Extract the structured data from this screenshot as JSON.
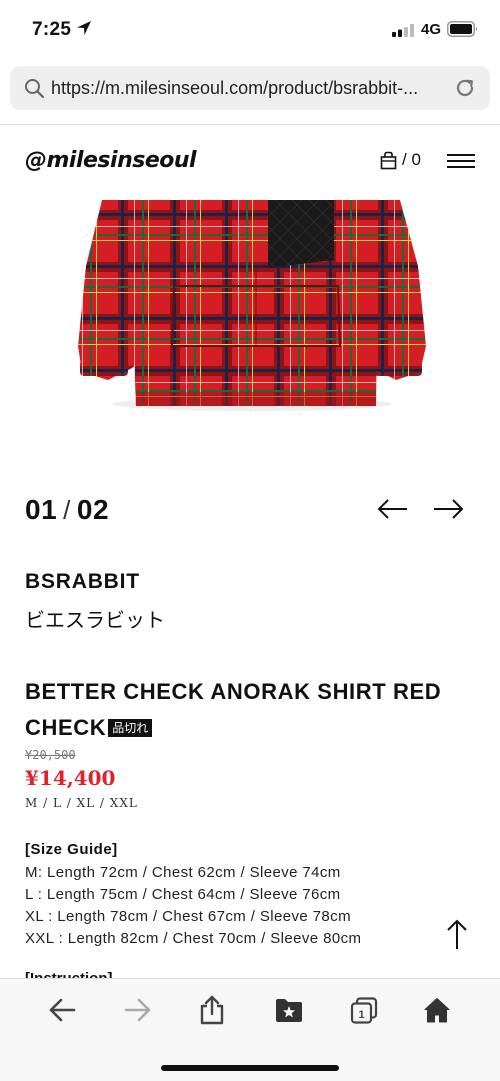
{
  "status_bar": {
    "time": "7:25",
    "network": "4G",
    "icons": [
      "location-arrow-icon",
      "signal-icon",
      "battery-icon"
    ]
  },
  "browser": {
    "url": "https://m.milesinseoul.com/product/bsrabbit-...",
    "icons": [
      "search-icon",
      "reload-icon"
    ]
  },
  "header": {
    "logo": "@milesinseoul",
    "cart_count": "/ 0",
    "icons": [
      "cart-icon",
      "hamburger-menu-icon"
    ]
  },
  "slider": {
    "current": "01",
    "separator": "/",
    "total": "02"
  },
  "product": {
    "brand": "BSRABBIT",
    "brand_jp": "ビエスラビット",
    "title": "BETTER CHECK ANORAK SHIRT RED CHECK",
    "soldout_badge": "品切れ",
    "old_price": "¥20,500",
    "price": "¥14,400",
    "sizes": "M / L / XL / XXL",
    "accent_color": "#e0222b"
  },
  "size_guide": {
    "heading": "[Size Guide]",
    "rows": [
      "M: Length 72cm / Chest 62cm / Sleeve 74cm",
      "L : Length 75cm / Chest 64cm / Sleeve 76cm",
      "XL : Length 78cm / Chest 67cm / Sleeve 78cm",
      "XXL : Length 82cm / Chest 70cm / Sleeve 80cm"
    ]
  },
  "instruction_heading": "[Instruction]",
  "toolbar": {
    "icons": [
      "back-arrow-icon",
      "forward-arrow-icon",
      "share-icon",
      "bookmarks-icon",
      "tabs-icon",
      "home-icon"
    ],
    "tab_count": "1"
  }
}
